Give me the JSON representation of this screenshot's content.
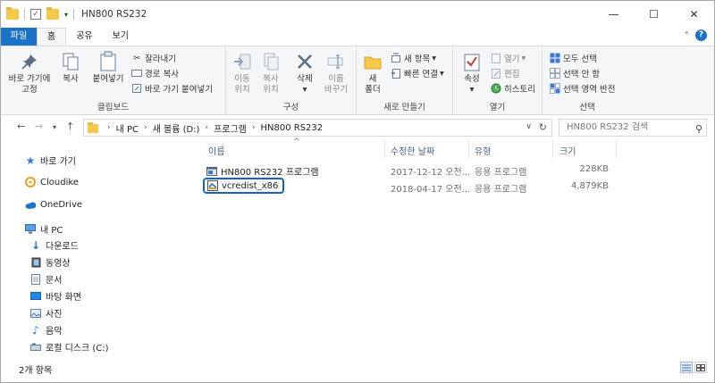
{
  "window": {
    "title": "HN800 RS232",
    "minimize": "—",
    "maximize": "☐",
    "close": "✕"
  },
  "quick_access": {
    "properties_icon": "checklist-icon",
    "folder_icon": "folder-icon",
    "dropdown": "▾"
  },
  "ribbon_tabs": [
    {
      "label": "파일"
    },
    {
      "label": "홈"
    },
    {
      "label": "공유"
    },
    {
      "label": "보기"
    }
  ],
  "ribbon": {
    "clipboard": {
      "label": "클립보드",
      "pin_label_1": "바로 가기에",
      "pin_label_2": "고정",
      "copy": "복사",
      "paste": "붙여넣기",
      "cut": "잘라내기",
      "copy_path": "경로 복사",
      "paste_shortcut": "바로 가기 붙여넣기"
    },
    "organize": {
      "label": "구성",
      "move_1": "이동",
      "move_2": "위치",
      "copyto_1": "복사",
      "copyto_2": "위치",
      "delete": "삭제",
      "rename_1": "이름",
      "rename_2": "바꾸기"
    },
    "new": {
      "label": "새로 만들기",
      "folder_1": "새",
      "folder_2": "폴더",
      "new_item": "새 항목",
      "easy_access": "빠른 연결"
    },
    "open": {
      "label": "열기",
      "properties": "속성",
      "open": "열기",
      "edit": "편집",
      "history": "히스토리"
    },
    "select": {
      "label": "선택",
      "select_all": "모두 선택",
      "select_none": "선택 안 함",
      "invert": "선택 영역 반전"
    }
  },
  "address": {
    "crumbs": [
      "내 PC",
      "새 볼륨 (D:)",
      "프로그램",
      "HN800 RS232"
    ],
    "search_placeholder": "HN800 RS232 검색"
  },
  "nav_pane": [
    {
      "label": "바로 가기",
      "icon": "star-icon"
    },
    {
      "label": "Cloudike",
      "icon": "cloud-icon"
    },
    {
      "label": "OneDrive",
      "icon": "onedrive-icon"
    },
    {
      "label": "내 PC",
      "icon": "pc-icon"
    },
    {
      "label": "다운로드",
      "icon": "download-icon"
    },
    {
      "label": "동영상",
      "icon": "video-icon"
    },
    {
      "label": "문서",
      "icon": "document-icon"
    },
    {
      "label": "바탕 화면",
      "icon": "desktop-icon"
    },
    {
      "label": "사진",
      "icon": "picture-icon"
    },
    {
      "label": "음악",
      "icon": "music-icon"
    },
    {
      "label": "로컬 디스크 (C:)",
      "icon": "disk-icon"
    }
  ],
  "columns": {
    "name": "이름",
    "modified": "수정한 날짜",
    "type": "유형",
    "size": "크기"
  },
  "files": [
    {
      "name": "HN800 RS232 프로그램",
      "modified": "2017-12-12 오전...",
      "type": "응용 프로그램",
      "size": "228KB"
    },
    {
      "name": "vcredist_x86",
      "modified": "2018-04-17 오전...",
      "type": "응용 프로그램",
      "size": "4,879KB"
    }
  ],
  "status": {
    "item_count": "2개 항목"
  },
  "colors": {
    "accent": "#1a73c6",
    "selection_outline": "#1565c0",
    "folder": "#f6c94a"
  }
}
